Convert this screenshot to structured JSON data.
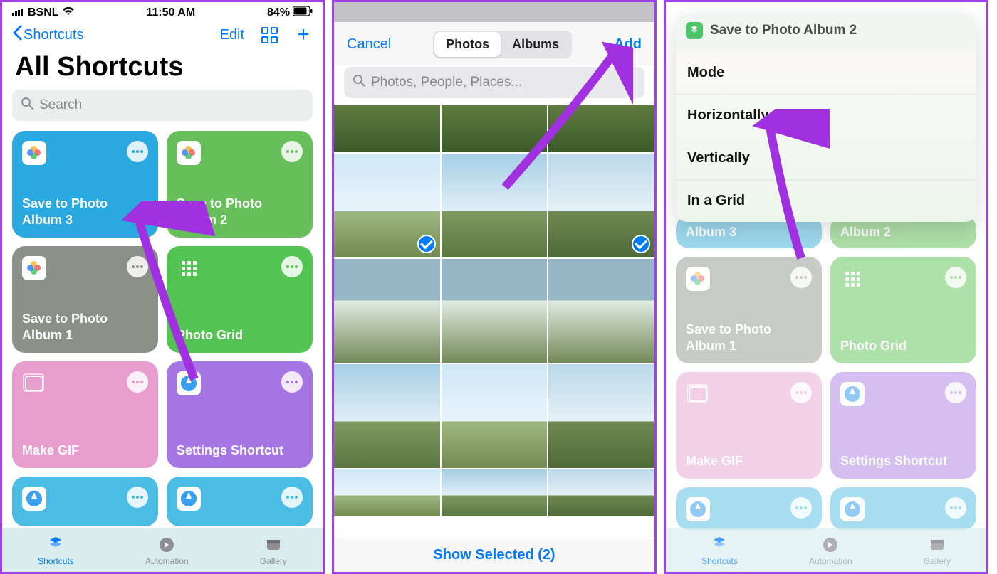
{
  "status": {
    "carrier": "BSNL",
    "time": "11:50 AM",
    "battery": "84%"
  },
  "panel1": {
    "back_label": "Shortcuts",
    "edit_label": "Edit",
    "title": "All Shortcuts",
    "search_placeholder": "Search",
    "tiles": [
      {
        "label": "Save to Photo Album 3",
        "color": "#2aa8e0",
        "icon": "photos",
        "dotColor": "#2aa8e0"
      },
      {
        "label": "Save to Photo Album 2",
        "color": "#66bf5b",
        "icon": "photos",
        "dotColor": "#66bf5b"
      },
      {
        "label": "Save to Photo Album 1",
        "color": "#8b9089",
        "icon": "photos",
        "dotColor": "#8b9089"
      },
      {
        "label": "Photo Grid",
        "color": "#53c451",
        "icon": "grid",
        "dotColor": "#53c451"
      },
      {
        "label": "Make GIF",
        "color": "#e79dce",
        "icon": "gif",
        "dotColor": "#e79dce"
      },
      {
        "label": "Settings Shortcut",
        "color": "#a576e3",
        "icon": "safari",
        "dotColor": "#a576e3"
      }
    ],
    "tabs": {
      "shortcuts": "Shortcuts",
      "automation": "Automation",
      "gallery": "Gallery"
    }
  },
  "panel2": {
    "cancel_label": "Cancel",
    "seg_photos": "Photos",
    "seg_albums": "Albums",
    "add_label": "Add",
    "search_placeholder": "Photos, People, Places...",
    "show_selected_label": "Show Selected (2)"
  },
  "panel3": {
    "sheet_title": "Save to Photo Album 2",
    "options": [
      "Mode",
      "Horizontally",
      "Vertically",
      "In a Grid"
    ],
    "bg_tiles": [
      {
        "label": "Album 3",
        "color": "#4cb7de"
      },
      {
        "label": "Album 2",
        "color": "#6cc461"
      },
      {
        "label": "Save to Photo Album 1",
        "color": "#9aa19a"
      },
      {
        "label": "Photo Grid",
        "color": "#6cc964"
      },
      {
        "label": "Make GIF",
        "color": "#e9abd3"
      },
      {
        "label": "Settings Shortcut",
        "color": "#b38ce7"
      }
    ]
  }
}
